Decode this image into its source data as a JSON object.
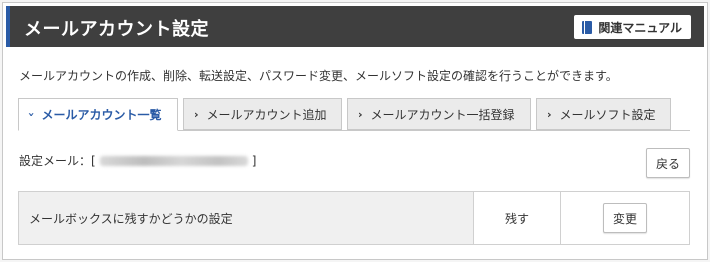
{
  "header": {
    "title": "メールアカウント設定",
    "manual_button": "関連マニュアル",
    "manual_icon": "book-icon",
    "accent_color": "#2a5ba6",
    "bg_color": "#3f3f3f"
  },
  "description": "メールアカウントの作成、削除、転送設定、パスワード変更、メールソフト設定の確認を行うことができます。",
  "tabs": [
    {
      "label": "メールアカウント一覧",
      "active": true
    },
    {
      "label": "メールアカウント追加",
      "active": false
    },
    {
      "label": "メールアカウント一括登録",
      "active": false
    },
    {
      "label": "メールソフト設定",
      "active": false
    }
  ],
  "email": {
    "prefix": "設定メール：[",
    "suffix": "]"
  },
  "back_button": "戻る",
  "setting_row": {
    "label": "メールボックスに残すかどうかの設定",
    "value": "残す",
    "action": "変更"
  }
}
